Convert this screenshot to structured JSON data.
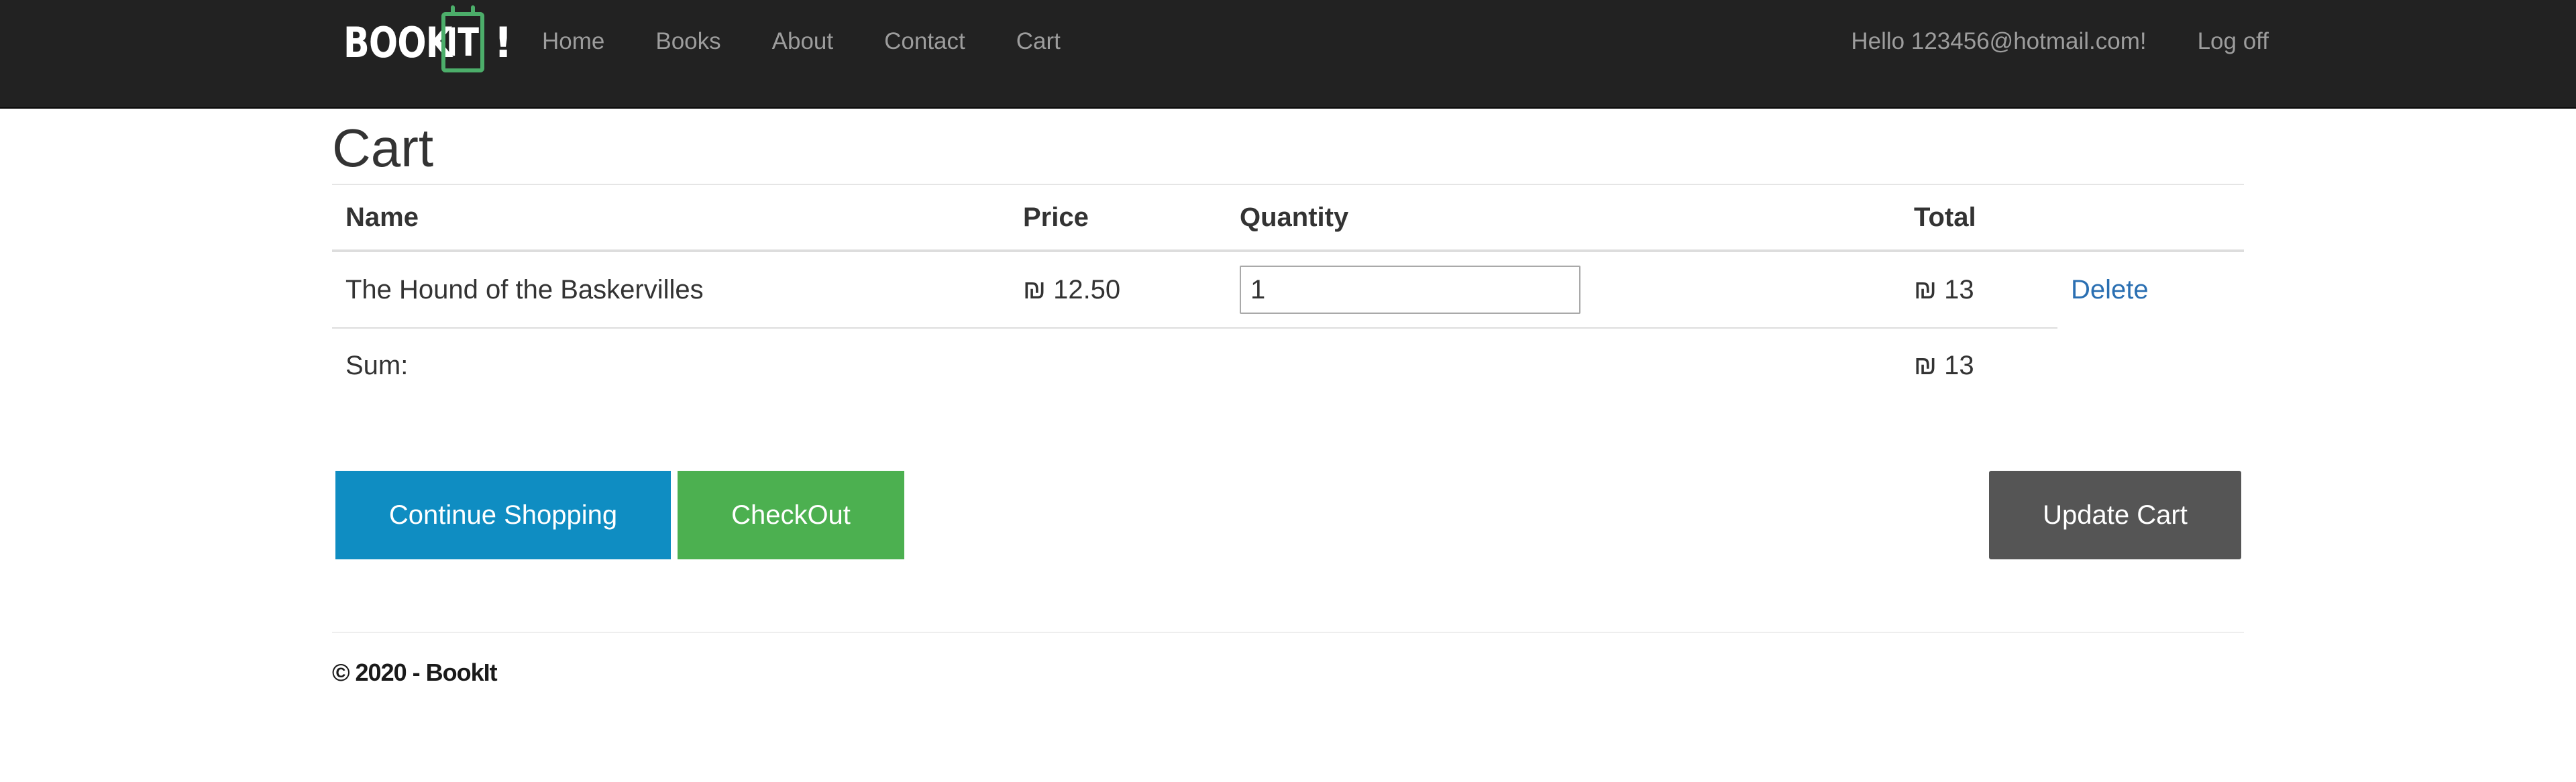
{
  "brand": {
    "word": "BOOK",
    "box_text": "IT",
    "bang": "!"
  },
  "nav": {
    "links": [
      "Home",
      "Books",
      "About",
      "Contact",
      "Cart"
    ],
    "greeting": "Hello 123456@hotmail.com!",
    "logoff": "Log off"
  },
  "page": {
    "title": "Cart"
  },
  "table": {
    "headers": {
      "name": "Name",
      "price": "Price",
      "quantity": "Quantity",
      "total": "Total"
    },
    "rows": [
      {
        "name": "The Hound of the Baskervilles",
        "price": "₪ 12.50",
        "quantity": "1",
        "total": "₪ 13",
        "action": "Delete"
      }
    ],
    "sum_label": "Sum:",
    "sum_value": "₪ 13"
  },
  "buttons": {
    "continue": "Continue Shopping",
    "checkout": "CheckOut",
    "update": "Update Cart"
  },
  "footer": {
    "text": "© 2020 - BookIt"
  },
  "colors": {
    "navbar": "#222222",
    "brand_green": "#4cae6a",
    "continue_button": "#0f8dc2",
    "checkout_button": "#4cb050",
    "update_button": "#555555",
    "link": "#2a6fb2"
  }
}
